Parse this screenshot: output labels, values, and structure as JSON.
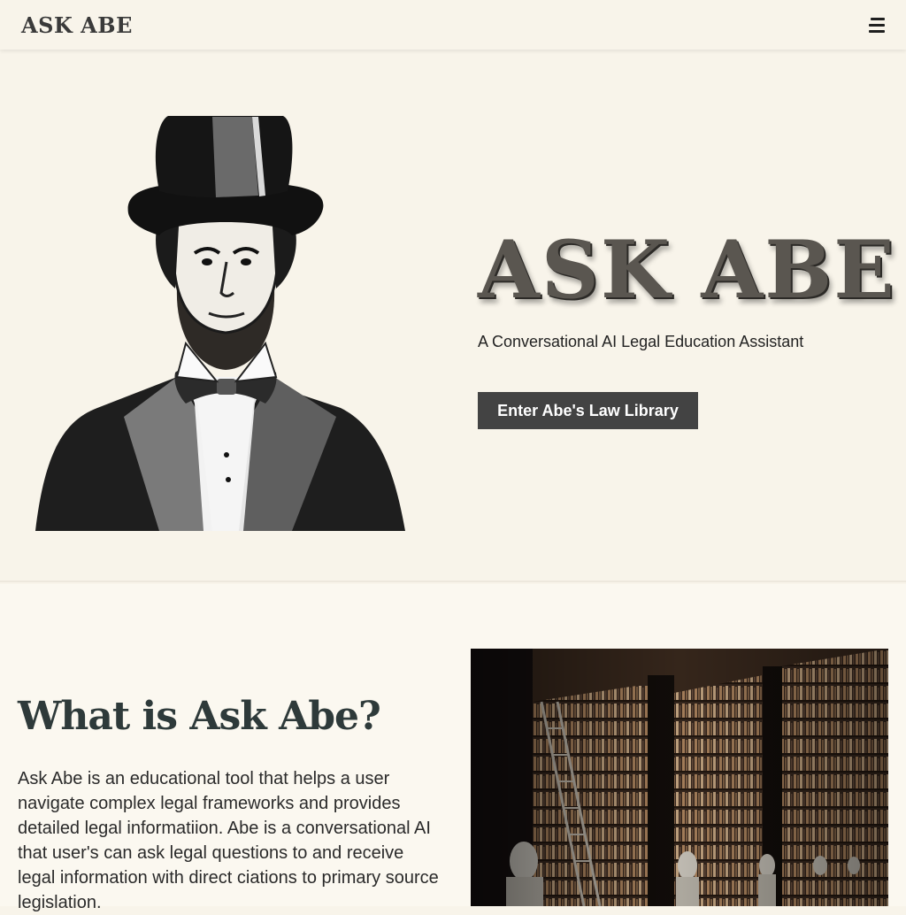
{
  "header": {
    "brand": "ASK ABE",
    "menu_icon": "hamburger-menu-icon"
  },
  "hero": {
    "title": "ASK ABE",
    "subtitle": "A Conversational AI Legal Education Assistant",
    "cta_label": "Enter Abe's Law Library"
  },
  "about": {
    "title": "What is Ask Abe?",
    "body": "Ask Abe is an educational tool that helps a user navigate complex legal frameworks and provides detailed legal informatiion. Abe is a conversational AI that user's can ask legal questions to and receive legal information with direct ciations to primary source legislation."
  },
  "colors": {
    "background": "#f8f4ea",
    "button": "#434343",
    "heading": "#2e3a3a"
  }
}
